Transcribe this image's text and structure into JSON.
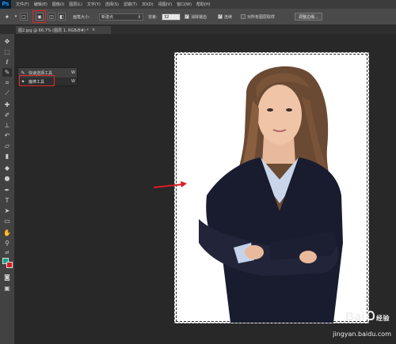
{
  "app": {
    "logo": "Ps"
  },
  "menu": [
    "文件(F)",
    "编辑(E)",
    "图像(I)",
    "图层(L)",
    "文字(Y)",
    "选择(S)",
    "滤镜(T)",
    "3D(D)",
    "视图(V)",
    "窗口(W)",
    "帮助(H)"
  ],
  "options": {
    "brush_size_label": "画笔大小:",
    "brush_select_value": "新建点",
    "hardness_label": "容差:",
    "hardness_value": "32",
    "antialias_label": "消除锯齿",
    "antialias_checked": true,
    "contiguous_label": "连续",
    "contiguous_checked": true,
    "all_layers_label": "对所有图层取样",
    "all_layers_checked": false,
    "refine_edge": "调整边缘..."
  },
  "document_tab": {
    "title": "图2.jpg @ 66.7% (图层 1, RGB/8#) *",
    "close": "×"
  },
  "flyout": {
    "items": [
      {
        "label": "快速选择工具",
        "shortcut": "W",
        "selected": false
      },
      {
        "label": "魔棒工具",
        "shortcut": "W",
        "selected": true
      }
    ]
  },
  "colors": {
    "foreground": "#14a383",
    "background": "#d61f26",
    "highlight": "#e0262a"
  },
  "watermark": {
    "logo": "Bai",
    "logo_tail": "经验",
    "url": "jingyan.baidu.com"
  }
}
